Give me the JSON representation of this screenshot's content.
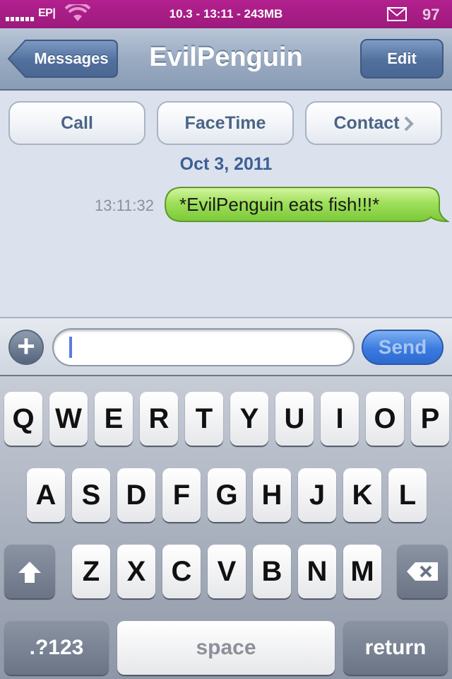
{
  "status_bar": {
    "carrier": "EP|",
    "center": "10.3 - 13:11 - 243MB",
    "battery": "97"
  },
  "nav": {
    "back_label": "Messages",
    "title": "EvilPenguin",
    "edit_label": "Edit"
  },
  "actions": {
    "call": "Call",
    "facetime": "FaceTime",
    "contact": "Contact"
  },
  "conversation": {
    "date": "Oct 3, 2011",
    "messages": [
      {
        "time": "13:11:32",
        "text": "*EvilPenguin eats fish!!!*"
      }
    ]
  },
  "compose": {
    "input_value": "",
    "send_label": "Send"
  },
  "keyboard": {
    "row1": [
      "Q",
      "W",
      "E",
      "R",
      "T",
      "Y",
      "U",
      "I",
      "O",
      "P"
    ],
    "row2": [
      "A",
      "S",
      "D",
      "F",
      "G",
      "H",
      "J",
      "K",
      "L"
    ],
    "row3": [
      "Z",
      "X",
      "C",
      "V",
      "B",
      "N",
      "M"
    ],
    "numbers_label": ".?123",
    "space_label": "space",
    "return_label": "return"
  },
  "colors": {
    "status_bar": "#b3208f",
    "bubble_green": "#8fd84a",
    "send_blue": "#3a7be0",
    "date_blue": "#3c5f94"
  }
}
